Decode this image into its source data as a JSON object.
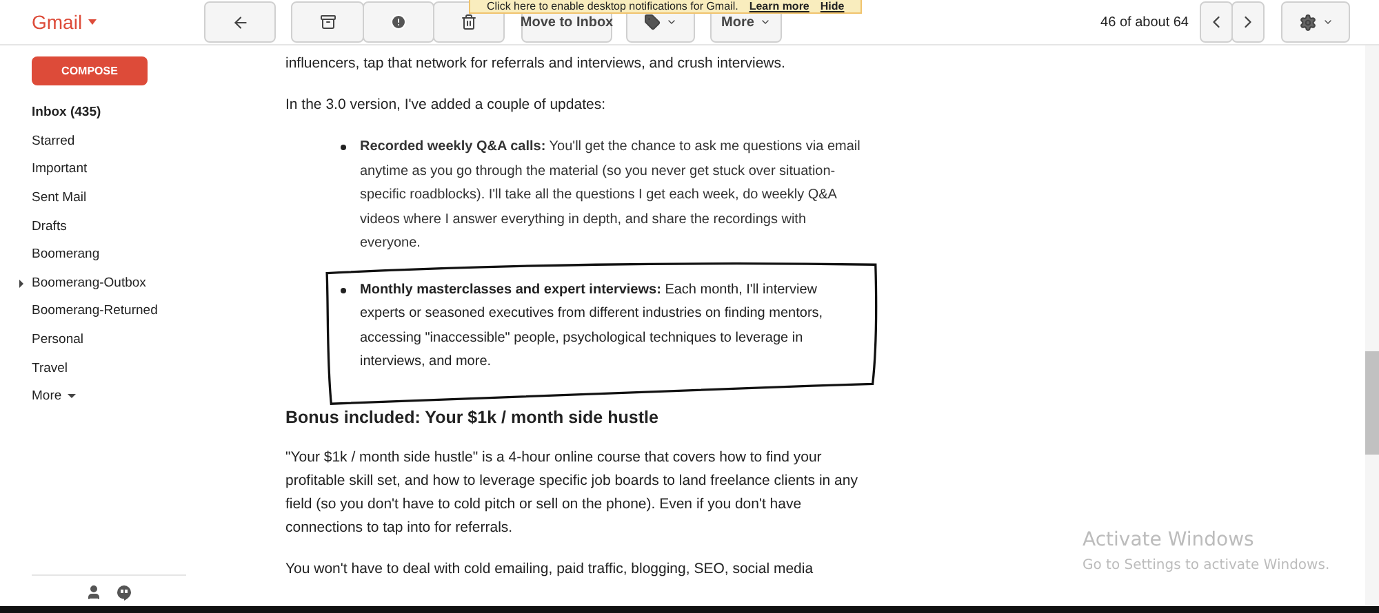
{
  "notification": {
    "text": "Click here to enable desktop notifications for Gmail.",
    "links": [
      "Learn more",
      "Hide"
    ]
  },
  "brand": "Gmail",
  "toolbar": {
    "move_to_inbox": "Move to Inbox",
    "more": "More",
    "pager": "46 of about 64"
  },
  "compose": "COMPOSE",
  "sidebar": {
    "items": [
      {
        "label": "Inbox (435)",
        "selected": true,
        "expandable": false
      },
      {
        "label": "Starred",
        "selected": false,
        "expandable": false
      },
      {
        "label": "Important",
        "selected": false,
        "expandable": false
      },
      {
        "label": "Sent Mail",
        "selected": false,
        "expandable": false
      },
      {
        "label": "Drafts",
        "selected": false,
        "expandable": false
      },
      {
        "label": "Boomerang",
        "selected": false,
        "expandable": false
      },
      {
        "label": "Boomerang-Outbox",
        "selected": false,
        "expandable": true
      },
      {
        "label": "Boomerang-Returned",
        "selected": false,
        "expandable": false
      },
      {
        "label": "Personal",
        "selected": false,
        "expandable": false
      },
      {
        "label": "Travel",
        "selected": false,
        "expandable": false
      }
    ],
    "more": "More"
  },
  "message": {
    "blocks": [
      {
        "kind": "paragraph",
        "text": "influencers, tap that network for referrals and interviews, and crush interviews."
      },
      {
        "kind": "paragraph",
        "text": "In the 3.0 version, I've added a couple of updates:"
      },
      {
        "kind": "bullet",
        "highlighted": false,
        "text": "**Recorded weekly Q&A calls:** You'll get the chance to ask me questions via email anytime as you go through the material (so you never get stuck over situation-specific roadblocks). I'll take all the questions I get each week, do weekly Q&A videos where I answer everything in depth, and share the recordings with everyone."
      },
      {
        "kind": "bullet",
        "highlighted": true,
        "text": "**Monthly masterclasses and expert interviews:** Each month, I'll interview experts or seasoned executives from different industries on finding mentors, accessing \"inaccessible\" people, psychological techniques to leverage in interviews, and more."
      },
      {
        "kind": "heading",
        "text": "Bonus included: Your $1k / month side hustle"
      },
      {
        "kind": "paragraph",
        "text": "\"Your $1k / month side hustle\" is a 4-hour online course that covers how to find your profitable skill set, and how to leverage specific job boards to land freelance clients in any field (so you don't have to cold pitch or sell on the phone). Even if you don't have connections to tap into for referrals."
      },
      {
        "kind": "paragraph",
        "text": "You won't have to deal with cold emailing, paid traffic, blogging, SEO, social media"
      }
    ]
  },
  "activation": {
    "title": "Activate Windows",
    "subtitle": "Go to Settings to activate Windows."
  }
}
